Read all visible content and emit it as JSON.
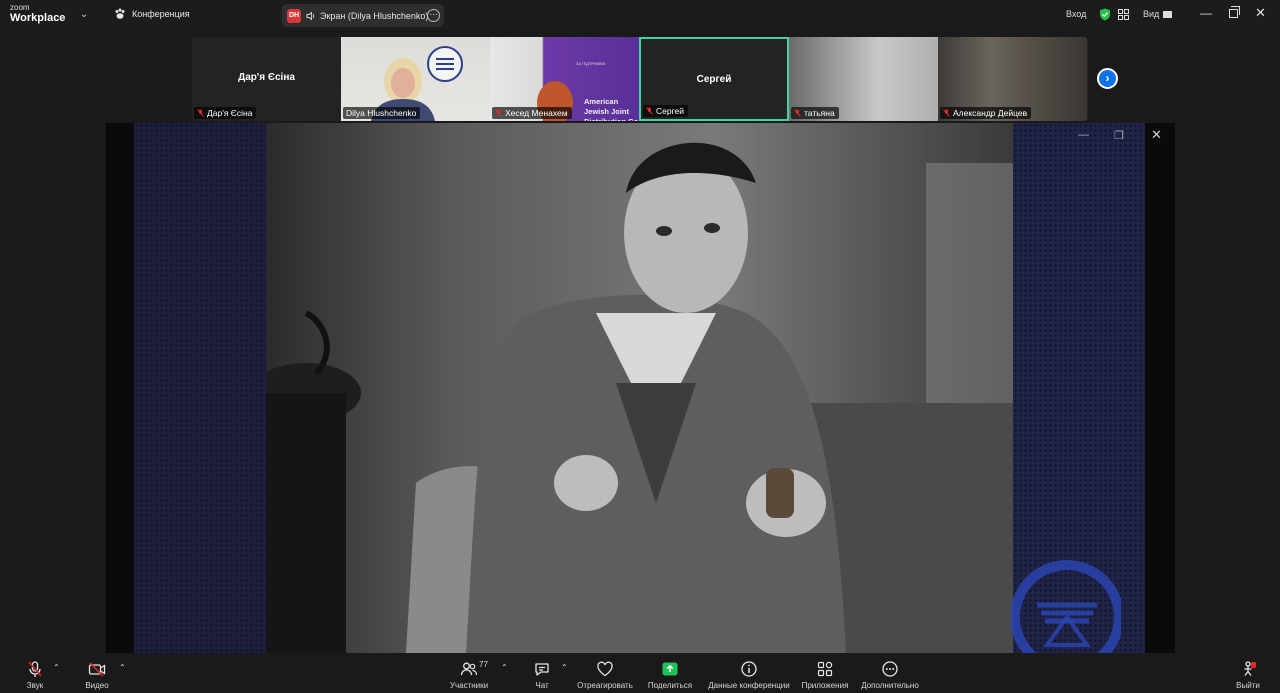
{
  "titlebar": {
    "logo_top": "zoom",
    "logo_bottom": "Workplace",
    "conference_label": "Конференция",
    "screen_tab_initials": "DH",
    "screen_tab_label": "Экран (Dilya Hlushchenko)",
    "signin_label": "Вход",
    "view_label": "Вид"
  },
  "participants": [
    {
      "big_name": "Дар'я Єсіна",
      "name": "Дар'я Єсіна",
      "type": "avatar",
      "muted": true
    },
    {
      "big_name": "",
      "name": "Dilya Hlushchenko",
      "type": "video",
      "muted": false
    },
    {
      "big_name": "",
      "name": "Хесед Менахем",
      "type": "video",
      "muted": true
    },
    {
      "big_name": "Сергей",
      "name": "Сергей",
      "type": "avatar",
      "muted": true,
      "active": true
    },
    {
      "big_name": "",
      "name": "татьяна",
      "type": "video",
      "muted": true
    },
    {
      "big_name": "",
      "name": "Александр Дейцев",
      "type": "video",
      "muted": true
    }
  ],
  "tile_banner_text": "American Jewish Joint Distribution Co",
  "tile_banner_top": "ЗА ПІДТРИМКИ",
  "toolbar": {
    "audio_label": "Звук",
    "video_label": "Видео",
    "participants_label": "Участники",
    "participants_count": "77",
    "chat_label": "Чат",
    "react_label": "Отреагировать",
    "share_label": "Поделиться",
    "info_label": "Данные конференции",
    "apps_label": "Приложения",
    "more_label": "Дополнительно",
    "leave_label": "Выйти"
  },
  "colors": {
    "accent_blue": "#0e72ed",
    "share_green": "#21c15a",
    "active_border": "#3fd6a1",
    "muted_red": "#e02828"
  }
}
